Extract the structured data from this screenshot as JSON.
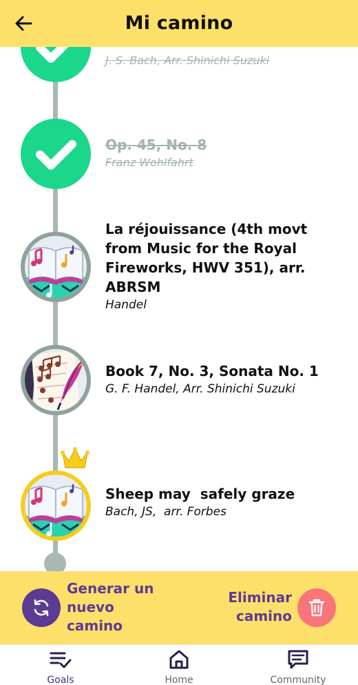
{
  "header": {
    "title": "Mi camino",
    "back_icon": "arrow-left-icon"
  },
  "path": {
    "pieces": [
      {
        "status": "completed",
        "title": "",
        "composer": "J. S. Bach, Arr. Shinichi Suzuki"
      },
      {
        "status": "completed",
        "title": "Op. 45, No. 8",
        "composer": "Franz Wohlfahrt"
      },
      {
        "status": "unlocked",
        "icon": "music-book-icon",
        "title": "La réjouissance (4th movt from Music for the Royal Fireworks, HWV 351), arr. ABRSM",
        "composer": "Handel"
      },
      {
        "status": "unlocked",
        "icon": "sheet-music-feather-icon",
        "title": "Book 7, No. 3, Sonata No. 1",
        "composer": "G. F. Handel, Arr. Shinichi Suzuki"
      },
      {
        "status": "current",
        "icon": "music-book-icon",
        "title": "Sheep may  safely graze",
        "composer": "Bach, JS,  arr. Forbes"
      }
    ]
  },
  "actions": {
    "generate_label": "Generar un nuevo camino",
    "delete_label": "Eliminar camino"
  },
  "nav": {
    "items": [
      {
        "label": "Goals",
        "icon": "goals-checklist-icon",
        "active": true
      },
      {
        "label": "Home",
        "icon": "home-icon",
        "active": false
      },
      {
        "label": "Community",
        "icon": "chat-icon",
        "active": false
      }
    ]
  },
  "colors": {
    "header_bg": "#fde069",
    "accent_purple": "#5d3a94",
    "done_green": "#1bd78b",
    "delete_red": "#f9757a",
    "path_gray": "#a7b9b3",
    "current_gold": "#f5cd1b"
  }
}
